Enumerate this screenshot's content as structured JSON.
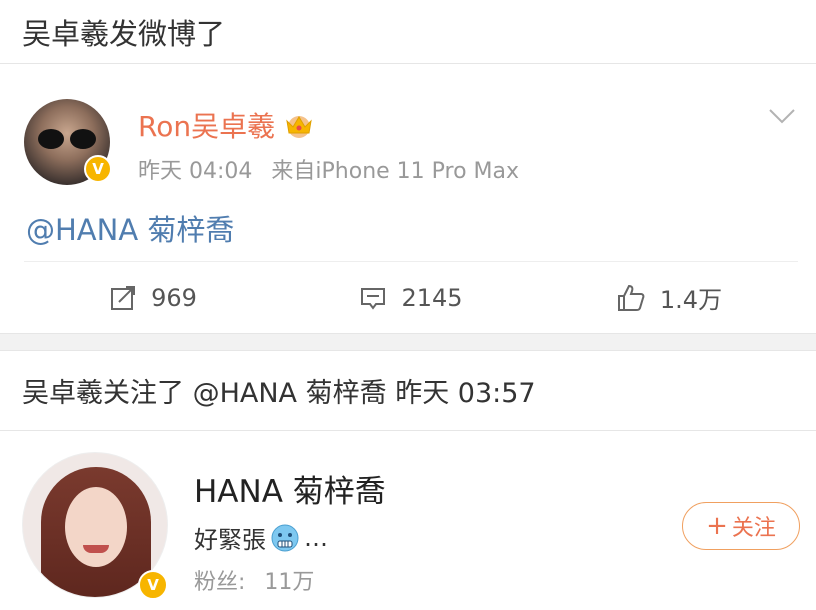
{
  "header": {
    "title": "吴卓羲发微博了"
  },
  "post": {
    "user_name": "Ron吴卓羲",
    "crown_icon": "crown-icon",
    "verified_icon": "verified-badge-icon",
    "time": "昨天 04:04",
    "source": "来自iPhone 11 Pro Max",
    "text": "@HANA 菊梓喬",
    "actions": {
      "repost_count": "969",
      "comment_count": "2145",
      "like_count": "1.4万"
    }
  },
  "follow_event": {
    "text": "吴卓羲关注了 @HANA 菊梓喬 昨天 03:57",
    "user": {
      "name": "HANA 菊梓喬",
      "bio_prefix": "好緊張",
      "bio_suffix": "…",
      "fans_label": "粉丝:",
      "fans_count": "11万"
    },
    "follow_button": {
      "plus": "+",
      "label": "关注"
    }
  },
  "colors": {
    "name_orange": "#eb7350",
    "link_blue": "#507daf",
    "meta_gray": "#999999",
    "verified_yellow": "#f7b500"
  }
}
